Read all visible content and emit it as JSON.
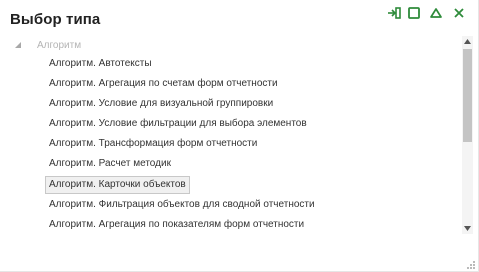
{
  "dialog": {
    "title": "Выбор типа"
  },
  "window_buttons": {
    "icons": [
      "dock-icon",
      "maximize-icon",
      "collapse-icon",
      "close-icon"
    ]
  },
  "tree": {
    "root_label": "Алгоритм",
    "items": [
      {
        "label": "Алгоритм. Автотексты"
      },
      {
        "label": "Алгоритм. Агрегация по счетам форм отчетности"
      },
      {
        "label": "Алгоритм. Условие для визуальной группировки"
      },
      {
        "label": "Алгоритм. Условие фильтрации для выбора элементов"
      },
      {
        "label": "Алгоритм. Трансформация форм отчетности"
      },
      {
        "label": "Алгоритм. Расчет методик"
      },
      {
        "label": "Алгоритм. Карточки объектов",
        "selected": true
      },
      {
        "label": "Алгоритм. Фильтрация объектов для сводной отчетности"
      },
      {
        "label": "Алгоритм. Агрегация по показателям форм отчетности"
      }
    ]
  },
  "colors": {
    "accent": "#2e8b3a",
    "selected_bg": "#f0f0f0",
    "root_text": "#b4b4b4"
  }
}
